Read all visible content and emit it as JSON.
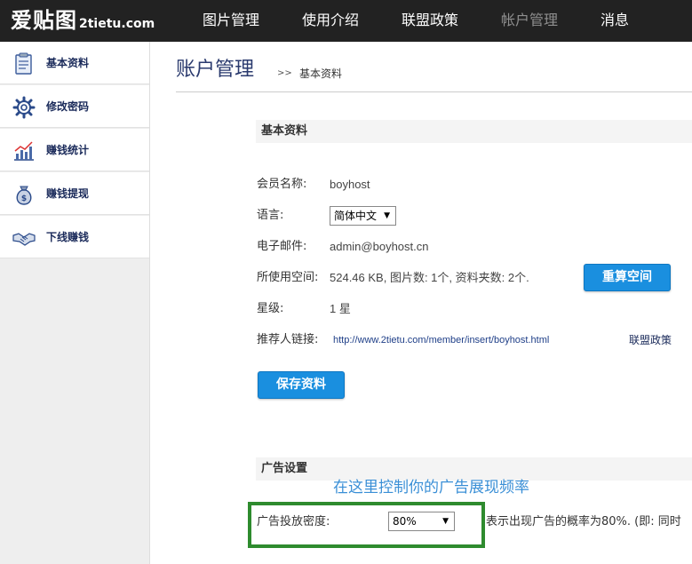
{
  "logo": {
    "cn": "爱贴图",
    "en": "2tietu.com"
  },
  "nav": [
    {
      "label": "图片管理",
      "active": false
    },
    {
      "label": "使用介绍",
      "active": false
    },
    {
      "label": "联盟政策",
      "active": false
    },
    {
      "label": "帐户管理",
      "active": true
    },
    {
      "label": "消息",
      "active": false
    }
  ],
  "sidebar": {
    "items": [
      {
        "label": "基本资料",
        "icon": "profile-sheet-icon"
      },
      {
        "label": "修改密码",
        "icon": "gear-icon"
      },
      {
        "label": "赚钱统计",
        "icon": "chart-icon"
      },
      {
        "label": "赚钱提现",
        "icon": "money-bag-icon"
      },
      {
        "label": "下线赚钱",
        "icon": "handshake-icon"
      }
    ]
  },
  "page": {
    "title": "账户管理",
    "crumb_sep": ">>",
    "crumb": "基本资料"
  },
  "profile": {
    "section_title": "基本资料",
    "member_label": "会员名称:",
    "member_value": "boyhost",
    "lang_label": "语言:",
    "lang_value": "简体中文",
    "email_label": "电子邮件:",
    "email_value": "admin@boyhost.cn",
    "space_label": "所使用空间:",
    "space_value": "524.46 KB, 图片数: 1个, 资料夹数: 2个.",
    "recalc_button": "重算空间",
    "star_label": "星级:",
    "star_value": "1 星",
    "ref_label": "推荐人链接:",
    "ref_value": "http://www.2tietu.com/member/insert/boyhost.html",
    "policy_link": "联盟政策",
    "save_button": "保存资料"
  },
  "ads": {
    "section_title": "广告设置",
    "annotation": "在这里控制你的广告展现频率",
    "density_label": "广告投放密度:",
    "density_value": "80%",
    "density_note": "表示出现广告的概率为80%. (即: 同时"
  },
  "colors": {
    "accent": "#1a8fdf",
    "highlight_box": "#2e8b2e",
    "annotation": "#3a8fd6",
    "topbar": "#222222"
  }
}
